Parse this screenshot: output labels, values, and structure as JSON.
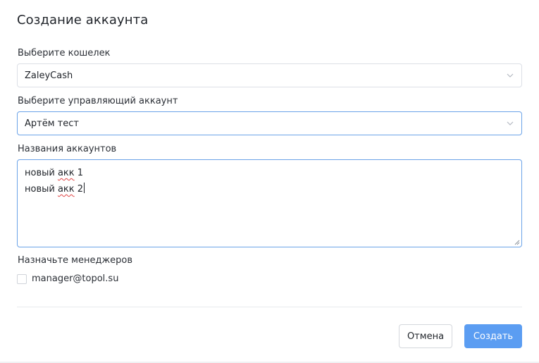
{
  "dialog": {
    "title": "Создание аккаунта"
  },
  "wallet": {
    "label": "Выберите кошелек",
    "value": "ZaleyCash"
  },
  "managing_account": {
    "label": "Выберите управляющий аккаунт",
    "value": "Артём тест"
  },
  "account_names": {
    "label": "Названия аккаунтов",
    "line1_prefix": "новый ",
    "line1_word": "акк",
    "line1_suffix": " 1",
    "line2_prefix": "новый ",
    "line2_word": "акк",
    "line2_suffix": " 2"
  },
  "managers": {
    "label": "Назначьте менеджеров",
    "options": [
      {
        "label": "manager@topol.su",
        "checked": false
      }
    ]
  },
  "footer": {
    "cancel_label": "Отмена",
    "create_label": "Создать"
  },
  "colors": {
    "accent": "#5b9df2",
    "focus_border": "#6aa2e8",
    "border": "#dcdfe6",
    "text": "#1f2329"
  }
}
